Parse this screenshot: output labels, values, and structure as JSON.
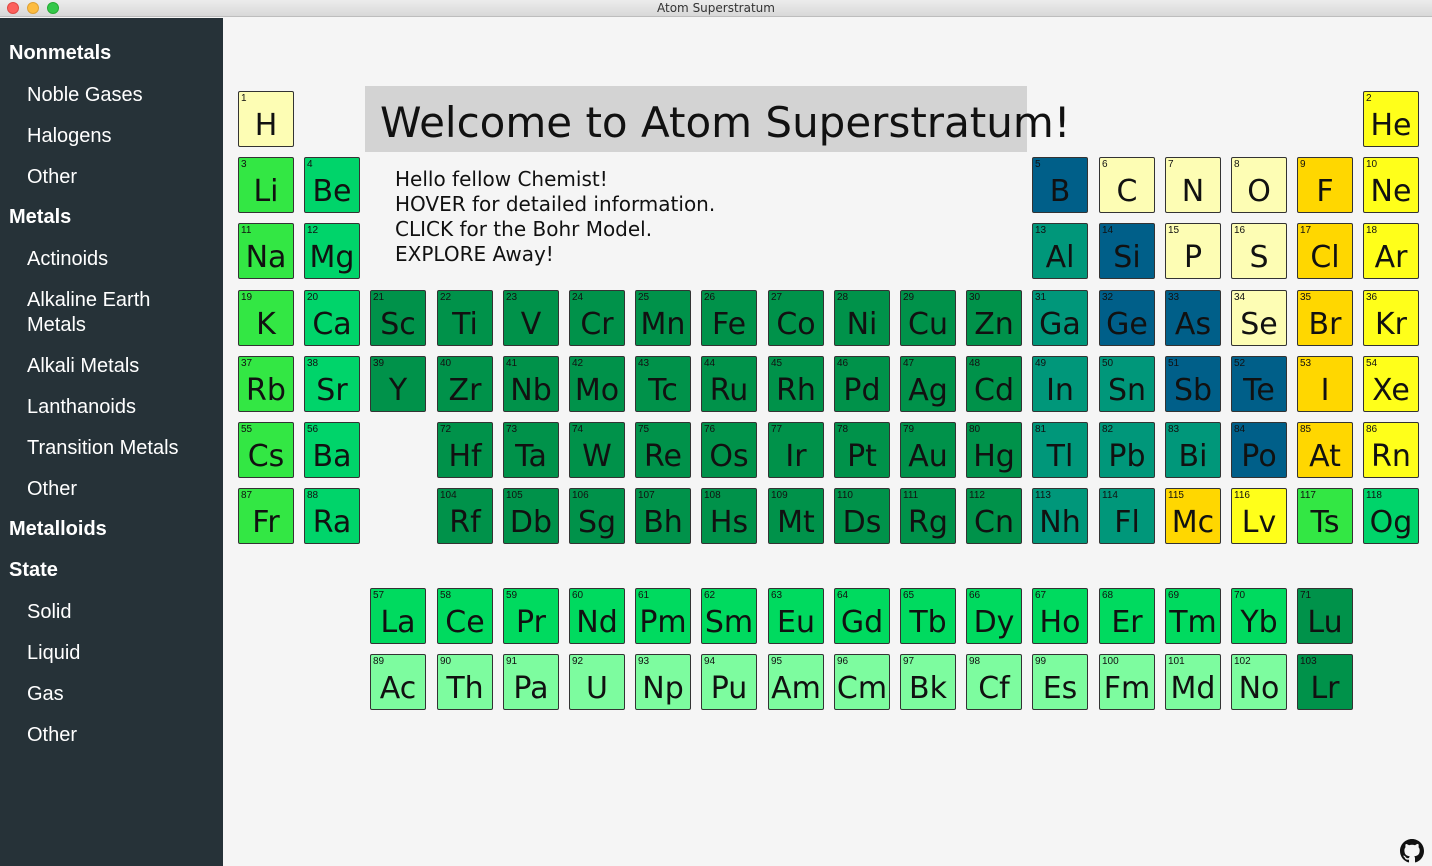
{
  "window": {
    "title": "Atom Superstratum"
  },
  "sidebar": {
    "nonmetals": "Nonmetals",
    "noble_gases": "Noble Gases",
    "halogens": "Halogens",
    "nonmetals_other": "Other",
    "metals": "Metals",
    "actinoids": "Actinoids",
    "alkaline_earth_line1": "Alkaline Earth",
    "alkaline_earth_line2": "Metals",
    "alkali_metals": "Alkali Metals",
    "lanthanoids": "Lanthanoids",
    "transition_metals": "Transition Metals",
    "metals_other": "Other",
    "metalloids": "Metalloids",
    "state": "State",
    "solid": "Solid",
    "liquid": "Liquid",
    "gas": "Gas",
    "state_other": "Other"
  },
  "welcome": {
    "title": "Welcome to Atom Superstratum!"
  },
  "intro": {
    "line1": "Hello fellow Chemist!",
    "line2": "HOVER for detailed information.",
    "line3": "CLICK for the Bohr Model.",
    "line4": "EXPLORE Away!"
  },
  "colors": {
    "nonmetal": "#fdfdb4",
    "noble": "#ffff1a",
    "halogen": "#ffd700",
    "transition": "#00924a",
    "alkaline": "#00d46a",
    "alkali": "#33e744",
    "lanthanoid": "#00da5f",
    "actinoid": "#7dfc9f",
    "post_transition": "#00977a",
    "metalloid": "#005f89"
  },
  "elements": [
    {
      "n": 1,
      "s": "H",
      "c": "nonmetal"
    },
    {
      "n": 2,
      "s": "He",
      "c": "noble"
    },
    {
      "n": 3,
      "s": "Li",
      "c": "alkali"
    },
    {
      "n": 4,
      "s": "Be",
      "c": "alkaline"
    },
    {
      "n": 5,
      "s": "B",
      "c": "metalloid"
    },
    {
      "n": 6,
      "s": "C",
      "c": "nonmetal"
    },
    {
      "n": 7,
      "s": "N",
      "c": "nonmetal"
    },
    {
      "n": 8,
      "s": "O",
      "c": "nonmetal"
    },
    {
      "n": 9,
      "s": "F",
      "c": "halogen"
    },
    {
      "n": 10,
      "s": "Ne",
      "c": "noble"
    },
    {
      "n": 11,
      "s": "Na",
      "c": "alkali"
    },
    {
      "n": 12,
      "s": "Mg",
      "c": "alkaline"
    },
    {
      "n": 13,
      "s": "Al",
      "c": "post_transition"
    },
    {
      "n": 14,
      "s": "Si",
      "c": "metalloid"
    },
    {
      "n": 15,
      "s": "P",
      "c": "nonmetal"
    },
    {
      "n": 16,
      "s": "S",
      "c": "nonmetal"
    },
    {
      "n": 17,
      "s": "Cl",
      "c": "halogen"
    },
    {
      "n": 18,
      "s": "Ar",
      "c": "noble"
    },
    {
      "n": 19,
      "s": "K",
      "c": "alkali"
    },
    {
      "n": 20,
      "s": "Ca",
      "c": "alkaline"
    },
    {
      "n": 21,
      "s": "Sc",
      "c": "transition"
    },
    {
      "n": 22,
      "s": "Ti",
      "c": "transition"
    },
    {
      "n": 23,
      "s": "V",
      "c": "transition"
    },
    {
      "n": 24,
      "s": "Cr",
      "c": "transition"
    },
    {
      "n": 25,
      "s": "Mn",
      "c": "transition"
    },
    {
      "n": 26,
      "s": "Fe",
      "c": "transition"
    },
    {
      "n": 27,
      "s": "Co",
      "c": "transition"
    },
    {
      "n": 28,
      "s": "Ni",
      "c": "transition"
    },
    {
      "n": 29,
      "s": "Cu",
      "c": "transition"
    },
    {
      "n": 30,
      "s": "Zn",
      "c": "transition"
    },
    {
      "n": 31,
      "s": "Ga",
      "c": "post_transition"
    },
    {
      "n": 32,
      "s": "Ge",
      "c": "metalloid"
    },
    {
      "n": 33,
      "s": "As",
      "c": "metalloid"
    },
    {
      "n": 34,
      "s": "Se",
      "c": "nonmetal"
    },
    {
      "n": 35,
      "s": "Br",
      "c": "halogen"
    },
    {
      "n": 36,
      "s": "Kr",
      "c": "noble"
    },
    {
      "n": 37,
      "s": "Rb",
      "c": "alkali"
    },
    {
      "n": 38,
      "s": "Sr",
      "c": "alkaline"
    },
    {
      "n": 39,
      "s": "Y",
      "c": "transition"
    },
    {
      "n": 40,
      "s": "Zr",
      "c": "transition"
    },
    {
      "n": 41,
      "s": "Nb",
      "c": "transition"
    },
    {
      "n": 42,
      "s": "Mo",
      "c": "transition"
    },
    {
      "n": 43,
      "s": "Tc",
      "c": "transition"
    },
    {
      "n": 44,
      "s": "Ru",
      "c": "transition"
    },
    {
      "n": 45,
      "s": "Rh",
      "c": "transition"
    },
    {
      "n": 46,
      "s": "Pd",
      "c": "transition"
    },
    {
      "n": 47,
      "s": "Ag",
      "c": "transition"
    },
    {
      "n": 48,
      "s": "Cd",
      "c": "transition"
    },
    {
      "n": 49,
      "s": "In",
      "c": "post_transition"
    },
    {
      "n": 50,
      "s": "Sn",
      "c": "post_transition"
    },
    {
      "n": 51,
      "s": "Sb",
      "c": "metalloid"
    },
    {
      "n": 52,
      "s": "Te",
      "c": "metalloid"
    },
    {
      "n": 53,
      "s": "I",
      "c": "halogen"
    },
    {
      "n": 54,
      "s": "Xe",
      "c": "noble"
    },
    {
      "n": 55,
      "s": "Cs",
      "c": "alkali"
    },
    {
      "n": 56,
      "s": "Ba",
      "c": "alkaline"
    },
    {
      "n": 72,
      "s": "Hf",
      "c": "transition"
    },
    {
      "n": 73,
      "s": "Ta",
      "c": "transition"
    },
    {
      "n": 74,
      "s": "W",
      "c": "transition"
    },
    {
      "n": 75,
      "s": "Re",
      "c": "transition"
    },
    {
      "n": 76,
      "s": "Os",
      "c": "transition"
    },
    {
      "n": 77,
      "s": "Ir",
      "c": "transition"
    },
    {
      "n": 78,
      "s": "Pt",
      "c": "transition"
    },
    {
      "n": 79,
      "s": "Au",
      "c": "transition"
    },
    {
      "n": 80,
      "s": "Hg",
      "c": "transition"
    },
    {
      "n": 81,
      "s": "Tl",
      "c": "post_transition"
    },
    {
      "n": 82,
      "s": "Pb",
      "c": "post_transition"
    },
    {
      "n": 83,
      "s": "Bi",
      "c": "post_transition"
    },
    {
      "n": 84,
      "s": "Po",
      "c": "metalloid"
    },
    {
      "n": 85,
      "s": "At",
      "c": "halogen"
    },
    {
      "n": 86,
      "s": "Rn",
      "c": "noble"
    },
    {
      "n": 87,
      "s": "Fr",
      "c": "alkali"
    },
    {
      "n": 88,
      "s": "Ra",
      "c": "alkaline"
    },
    {
      "n": 104,
      "s": "Rf",
      "c": "transition"
    },
    {
      "n": 105,
      "s": "Db",
      "c": "transition"
    },
    {
      "n": 106,
      "s": "Sg",
      "c": "transition"
    },
    {
      "n": 107,
      "s": "Bh",
      "c": "transition"
    },
    {
      "n": 108,
      "s": "Hs",
      "c": "transition"
    },
    {
      "n": 109,
      "s": "Mt",
      "c": "transition"
    },
    {
      "n": 110,
      "s": "Ds",
      "c": "transition"
    },
    {
      "n": 111,
      "s": "Rg",
      "c": "transition"
    },
    {
      "n": 112,
      "s": "Cn",
      "c": "transition"
    },
    {
      "n": 113,
      "s": "Nh",
      "c": "post_transition"
    },
    {
      "n": 114,
      "s": "Fl",
      "c": "post_transition"
    },
    {
      "n": 115,
      "s": "Mc",
      "c": "halogen"
    },
    {
      "n": 116,
      "s": "Lv",
      "c": "noble"
    },
    {
      "n": 117,
      "s": "Ts",
      "c": "alkali"
    },
    {
      "n": 118,
      "s": "Og",
      "c": "alkaline"
    },
    {
      "n": 57,
      "s": "La",
      "c": "lanthanoid"
    },
    {
      "n": 58,
      "s": "Ce",
      "c": "lanthanoid"
    },
    {
      "n": 59,
      "s": "Pr",
      "c": "lanthanoid"
    },
    {
      "n": 60,
      "s": "Nd",
      "c": "lanthanoid"
    },
    {
      "n": 61,
      "s": "Pm",
      "c": "lanthanoid"
    },
    {
      "n": 62,
      "s": "Sm",
      "c": "lanthanoid"
    },
    {
      "n": 63,
      "s": "Eu",
      "c": "lanthanoid"
    },
    {
      "n": 64,
      "s": "Gd",
      "c": "lanthanoid"
    },
    {
      "n": 65,
      "s": "Tb",
      "c": "lanthanoid"
    },
    {
      "n": 66,
      "s": "Dy",
      "c": "lanthanoid"
    },
    {
      "n": 67,
      "s": "Ho",
      "c": "lanthanoid"
    },
    {
      "n": 68,
      "s": "Er",
      "c": "lanthanoid"
    },
    {
      "n": 69,
      "s": "Tm",
      "c": "lanthanoid"
    },
    {
      "n": 70,
      "s": "Yb",
      "c": "lanthanoid"
    },
    {
      "n": 71,
      "s": "Lu",
      "c": "transition"
    },
    {
      "n": 89,
      "s": "Ac",
      "c": "actinoid"
    },
    {
      "n": 90,
      "s": "Th",
      "c": "actinoid"
    },
    {
      "n": 91,
      "s": "Pa",
      "c": "actinoid"
    },
    {
      "n": 92,
      "s": "U",
      "c": "actinoid"
    },
    {
      "n": 93,
      "s": "Np",
      "c": "actinoid"
    },
    {
      "n": 94,
      "s": "Pu",
      "c": "actinoid"
    },
    {
      "n": 95,
      "s": "Am",
      "c": "actinoid"
    },
    {
      "n": 96,
      "s": "Cm",
      "c": "actinoid"
    },
    {
      "n": 97,
      "s": "Bk",
      "c": "actinoid"
    },
    {
      "n": 98,
      "s": "Cf",
      "c": "actinoid"
    },
    {
      "n": 99,
      "s": "Es",
      "c": "actinoid"
    },
    {
      "n": 100,
      "s": "Fm",
      "c": "actinoid"
    },
    {
      "n": 101,
      "s": "Md",
      "c": "actinoid"
    },
    {
      "n": 102,
      "s": "No",
      "c": "actinoid"
    },
    {
      "n": 103,
      "s": "Lr",
      "c": "transition"
    }
  ],
  "footer": {
    "github_icon": "github-icon"
  }
}
